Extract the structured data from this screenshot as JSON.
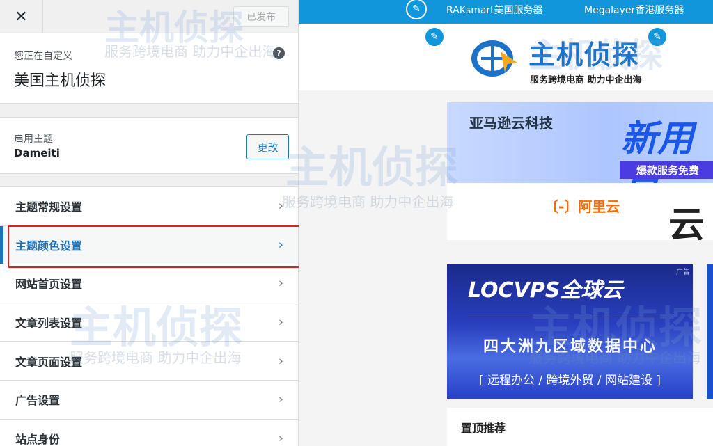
{
  "topbar": {
    "close_glyph": "✕",
    "publish_label": "已发布"
  },
  "info": {
    "subtitle": "您正在自定义",
    "site_name": "美国主机侦探",
    "help_glyph": "?"
  },
  "theme": {
    "label": "启用主题",
    "name": "Dameiti",
    "change_label": "更改"
  },
  "menu": {
    "items": [
      {
        "label": "主题常规设置"
      },
      {
        "label": "主题颜色设置"
      },
      {
        "label": "网站首页设置"
      },
      {
        "label": "文章列表设置"
      },
      {
        "label": "文章页面设置"
      },
      {
        "label": "广告设置"
      },
      {
        "label": "站点身份"
      }
    ],
    "active_index": 1,
    "chevron": "›"
  },
  "preview": {
    "nav": {
      "link1": "RAKsmart美国服务器",
      "link2": "Megalayer香港服务器",
      "pen_glyph": "✎"
    },
    "logo": {
      "text": "主机侦探",
      "slogan": "服务跨境电商 助力中企出海"
    },
    "ad1": {
      "brand": "亚马逊云科技",
      "headline": "新用户",
      "sub": "爆款服务免费"
    },
    "ad2": {
      "brand": "〔-〕阿里云",
      "headline": "云"
    },
    "ad3": {
      "tag": "广告",
      "title": "LOCVPS全球云",
      "subtitle": "四大洲九区域数据中心",
      "services": "[ 远程办公 / 跨境外贸 / 网站建设 ]"
    },
    "sticky_title": "置顶推荐"
  },
  "watermark": {
    "brand": "主机侦探",
    "slogan": "服务跨境电商 助力中企出海"
  },
  "colors": {
    "accent": "#2271b1",
    "highlight": "#e02020",
    "nav_blue": "#1296db"
  }
}
